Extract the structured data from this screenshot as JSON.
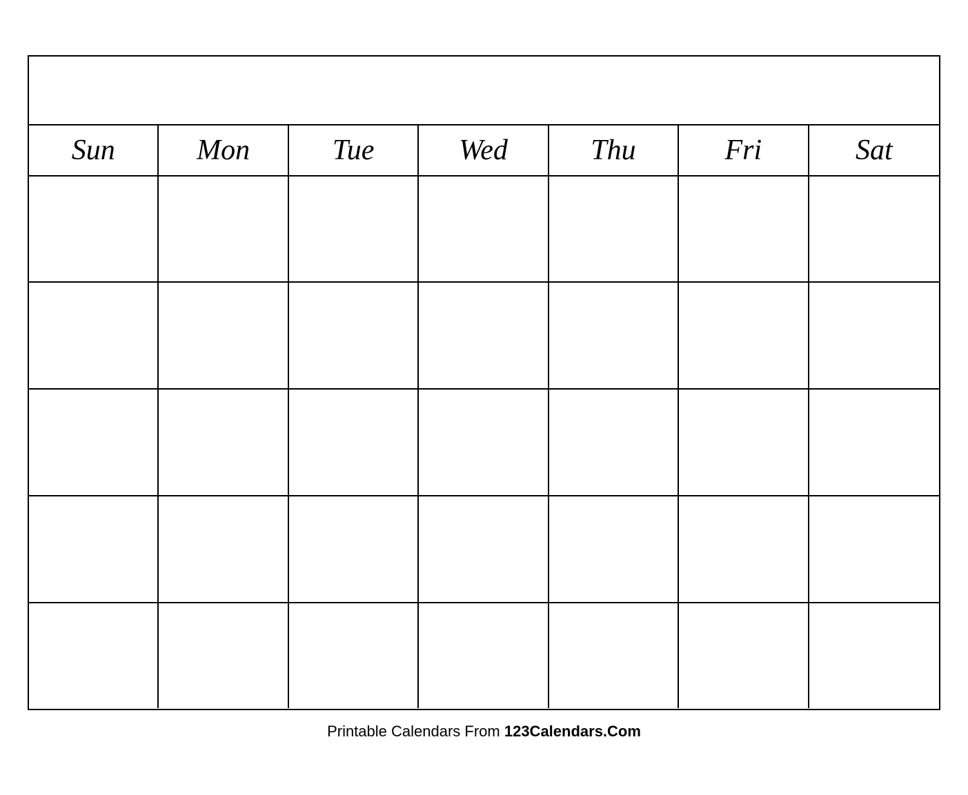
{
  "calendar": {
    "days": [
      "Sun",
      "Mon",
      "Tue",
      "Wed",
      "Thu",
      "Fri",
      "Sat"
    ],
    "rows": 5
  },
  "footer": {
    "text_normal": "Printable Calendars From ",
    "text_bold": "123Calendars.Com"
  }
}
